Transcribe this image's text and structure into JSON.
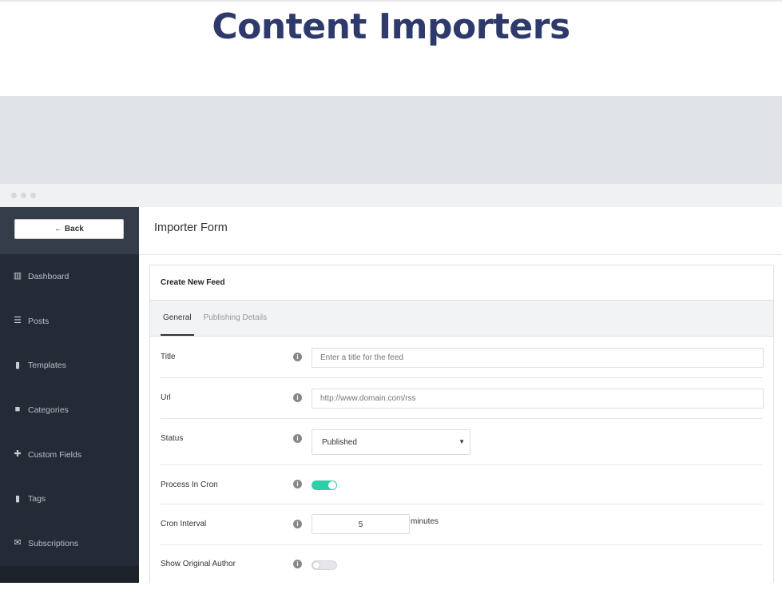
{
  "heading": "Content Importers",
  "sidebar": {
    "back_label": "← Back",
    "items": [
      {
        "label": "Dashboard",
        "icon": "chart-icon"
      },
      {
        "label": "Posts",
        "icon": "list-icon"
      },
      {
        "label": "Templates",
        "icon": "file-icon"
      },
      {
        "label": "Categories",
        "icon": "folder-icon"
      },
      {
        "label": "Custom Fields",
        "icon": "puzzle-icon"
      },
      {
        "label": "Tags",
        "icon": "bookmark-icon"
      },
      {
        "label": "Subscriptions",
        "icon": "envelope-icon"
      }
    ]
  },
  "main": {
    "title": "Importer Form",
    "card_title": "Create New Feed",
    "tabs": [
      {
        "label": "General",
        "active": true
      },
      {
        "label": "Publishing Details",
        "active": false
      }
    ],
    "fields": {
      "title": {
        "label": "Title",
        "placeholder": "Enter a title for the feed"
      },
      "url": {
        "label": "Url",
        "placeholder": "http://www.domain.com/rss"
      },
      "status": {
        "label": "Status",
        "value": "Published"
      },
      "cron": {
        "label": "Process In Cron",
        "on": true
      },
      "interval": {
        "label": "Cron Interval",
        "value": "5",
        "unit": "minutes"
      },
      "author": {
        "label": "Show Original Author",
        "on": false
      }
    }
  },
  "colors": {
    "accent": "#2ecfa6",
    "heading": "#2d3a6b",
    "sidebar": "#252b36"
  }
}
